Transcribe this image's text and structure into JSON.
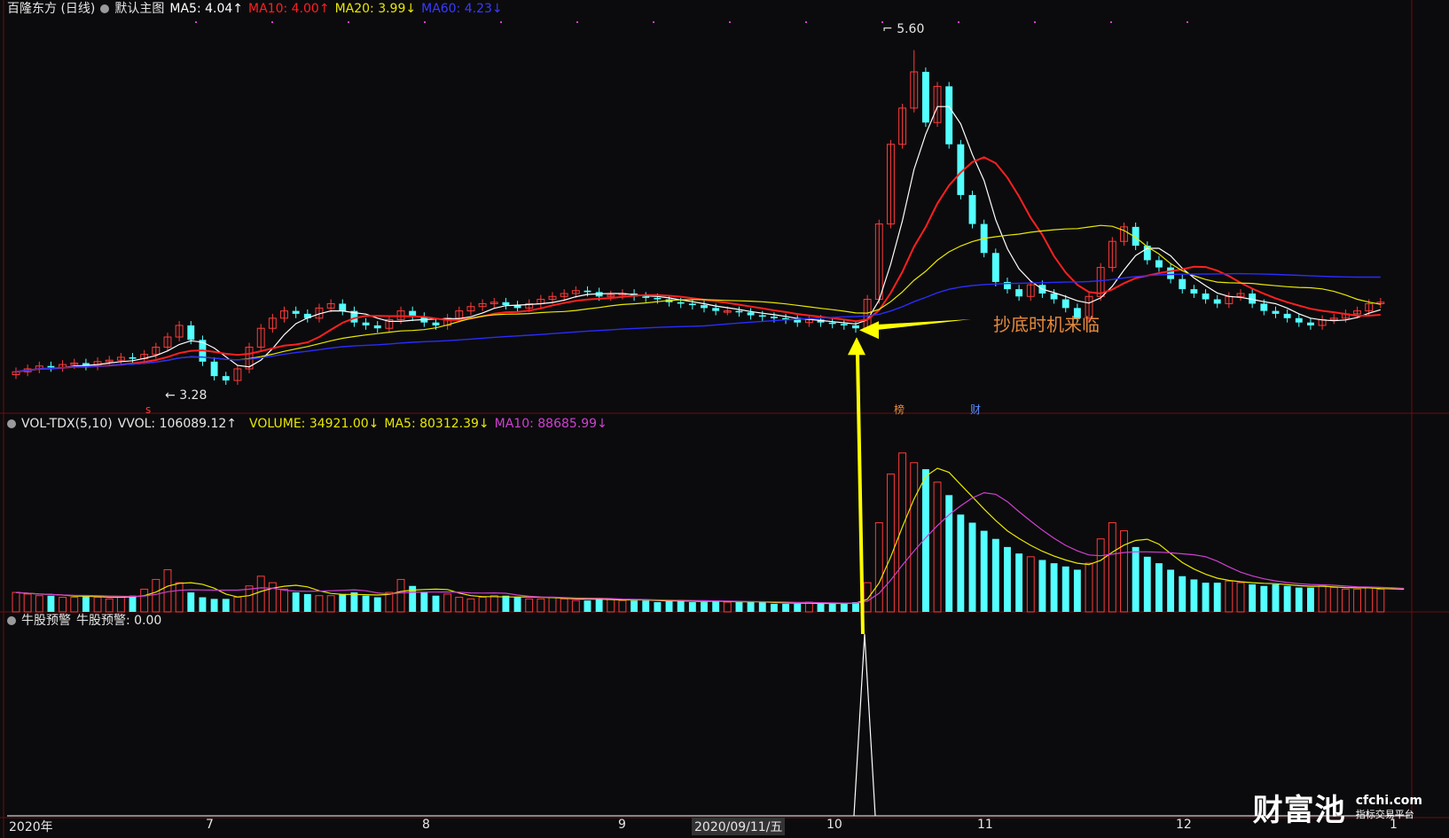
{
  "header": {
    "stock_title": "百隆东方 (日线)",
    "main_chart_label": "默认主图",
    "ma5": "MA5: 4.04↑",
    "ma10": "MA10: 4.00↑",
    "ma20": "MA20: 3.99↓",
    "ma60": "MA60: 4.23↓"
  },
  "volume_header": {
    "label": "VOL-TDX(5,10)",
    "vvol": "VVOL: 106089.12↑",
    "volume": "VOLUME: 34921.00↓",
    "ma5": "MA5: 80312.39↓",
    "ma10": "MA10: 88685.99↓"
  },
  "indicator_header": {
    "label": "牛股预警",
    "value": "牛股预警: 0.00"
  },
  "annotations": {
    "high_label": "5.60",
    "low_label": "3.28",
    "callout": "抄底时机来临",
    "marker_bang": "榜",
    "marker_cai": "财",
    "marker_s": "s"
  },
  "x_axis": {
    "year_label": "2020年",
    "months": [
      "7",
      "8",
      "9",
      "10",
      "11",
      "12",
      "1"
    ],
    "cursor_date": "2020/09/11/五"
  },
  "watermark": {
    "brand": "财富池",
    "site": "cfchi.com",
    "subtitle": "指标交易平台"
  },
  "colors": {
    "up": "#ff3b3b",
    "down": "#54ffff",
    "ma5": "#ffffff",
    "ma10": "#ff2020",
    "ma20": "#e8e800",
    "ma60": "#2b2bff",
    "vol_ma10": "#d040d0",
    "arrow": "#ffff00",
    "callout": "#e58a3c"
  },
  "chart_data": {
    "type": "candlestick",
    "title": "",
    "xlabel": "",
    "ylabel": "",
    "price_range": [
      3.28,
      5.6
    ],
    "anchor_points": [
      {
        "label": "low",
        "price": 3.28
      },
      {
        "label": "high",
        "price": 5.6
      }
    ],
    "price_series_approx": [
      3.38,
      3.4,
      3.42,
      3.41,
      3.43,
      3.44,
      3.42,
      3.45,
      3.46,
      3.48,
      3.47,
      3.5,
      3.55,
      3.62,
      3.7,
      3.6,
      3.45,
      3.35,
      3.32,
      3.4,
      3.55,
      3.68,
      3.75,
      3.8,
      3.78,
      3.75,
      3.82,
      3.85,
      3.8,
      3.72,
      3.7,
      3.68,
      3.74,
      3.8,
      3.76,
      3.72,
      3.7,
      3.75,
      3.8,
      3.83,
      3.85,
      3.86,
      3.84,
      3.82,
      3.85,
      3.88,
      3.9,
      3.92,
      3.94,
      3.93,
      3.9,
      3.91,
      3.92,
      3.9,
      3.89,
      3.88,
      3.86,
      3.85,
      3.84,
      3.82,
      3.8,
      3.8,
      3.79,
      3.77,
      3.76,
      3.75,
      3.74,
      3.72,
      3.74,
      3.72,
      3.71,
      3.7,
      3.68,
      3.88,
      4.4,
      4.95,
      5.2,
      5.45,
      5.1,
      5.35,
      4.95,
      4.6,
      4.4,
      4.2,
      4.0,
      3.95,
      3.9,
      3.98,
      3.92,
      3.88,
      3.82,
      3.75,
      3.9,
      4.1,
      4.28,
      4.38,
      4.25,
      4.15,
      4.1,
      4.02,
      3.95,
      3.92,
      3.88,
      3.85,
      3.9,
      3.92,
      3.85,
      3.8,
      3.78,
      3.75,
      3.72,
      3.7,
      3.74,
      3.75,
      3.78,
      3.8,
      3.85,
      3.86
    ],
    "volume_series_approx": [
      12,
      11,
      10,
      10,
      9,
      9,
      10,
      9,
      8,
      9,
      10,
      14,
      20,
      26,
      18,
      12,
      9,
      8,
      8,
      9,
      16,
      22,
      18,
      14,
      12,
      11,
      10,
      10,
      11,
      12,
      10,
      9,
      12,
      20,
      16,
      12,
      10,
      11,
      9,
      8,
      9,
      10,
      10,
      9,
      8,
      8,
      9,
      8,
      7,
      7,
      8,
      8,
      7,
      7,
      7,
      6,
      7,
      7,
      6,
      6,
      7,
      6,
      6,
      6,
      6,
      5,
      5,
      5,
      6,
      5,
      5,
      5,
      6,
      18,
      55,
      85,
      98,
      92,
      88,
      80,
      72,
      60,
      55,
      50,
      45,
      40,
      36,
      34,
      32,
      30,
      28,
      26,
      30,
      45,
      55,
      50,
      40,
      34,
      30,
      26,
      22,
      20,
      18,
      18,
      19,
      18,
      17,
      16,
      17,
      16,
      15,
      15,
      16,
      15,
      14,
      14,
      15,
      14,
      14,
      13
    ],
    "ma_labels": [
      "MA5: 4.04",
      "MA10: 4.00",
      "MA20: 3.99",
      "MA60: 4.23"
    ],
    "volume_labels": [
      "VOLUME: 34921.00",
      "MA5: 80312.39",
      "MA10: 88685.99"
    ],
    "x_tick_labels": [
      "2020年",
      "7",
      "8",
      "9",
      "10",
      "11",
      "12",
      "1"
    ],
    "legend_position": "top-left",
    "grid": false
  }
}
